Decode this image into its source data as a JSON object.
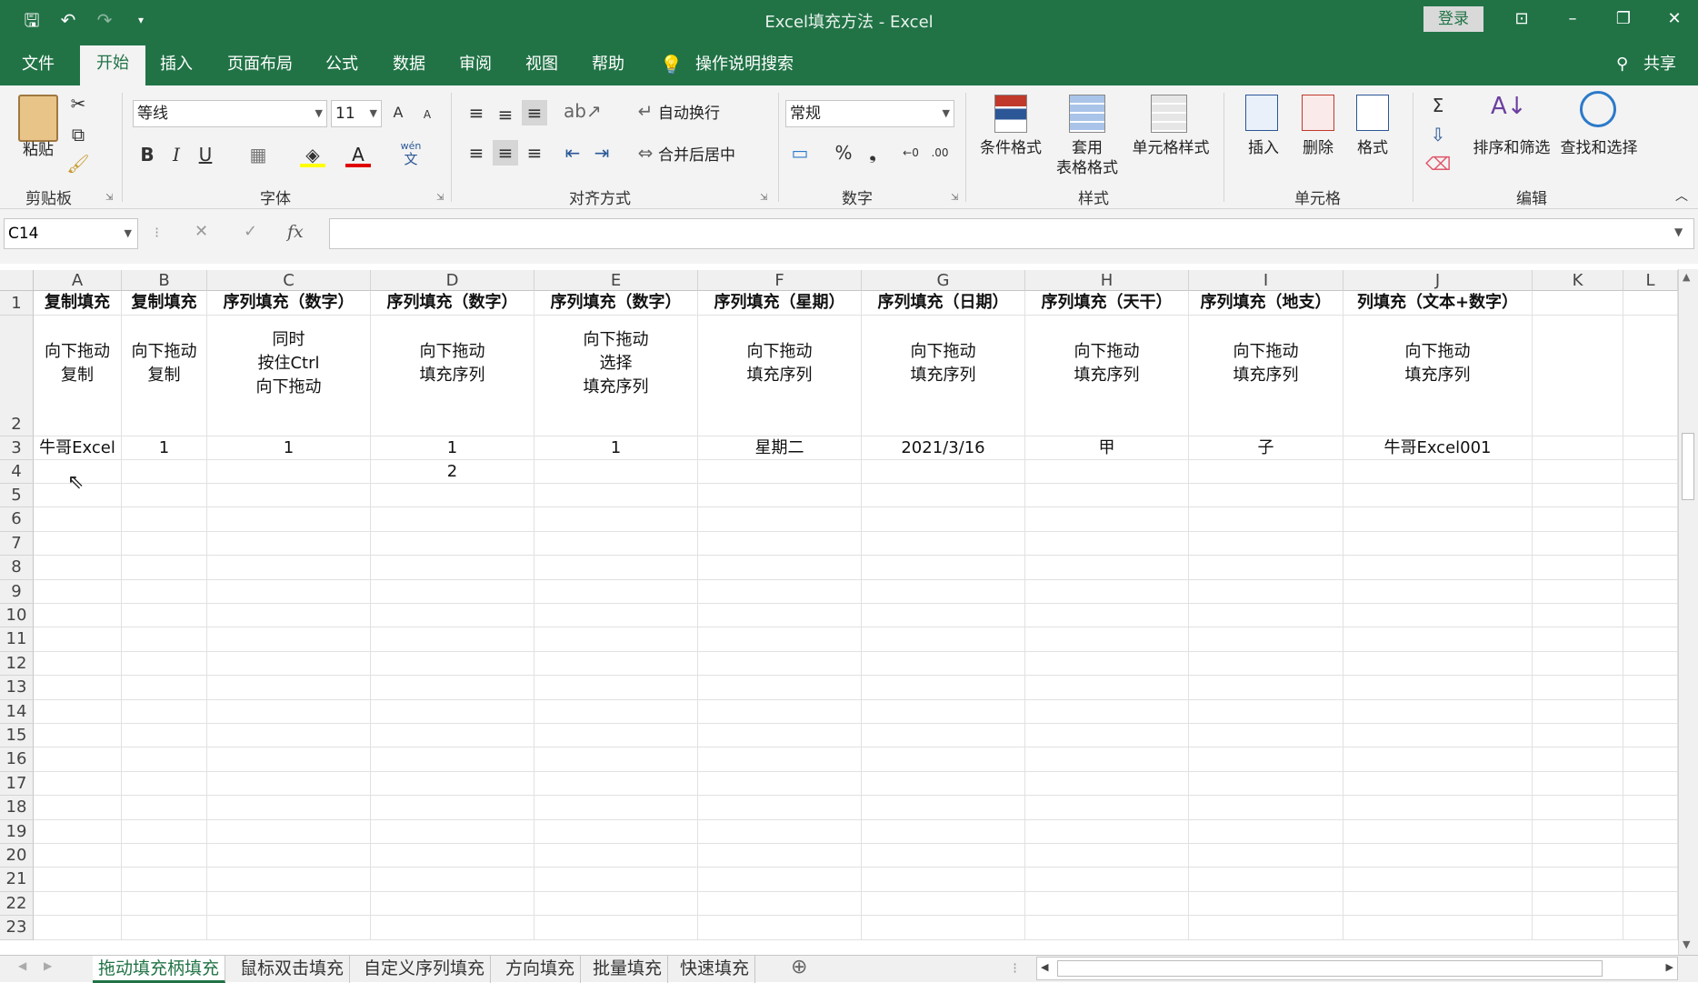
{
  "titlebar": {
    "title": "Excel填充方法  -  Excel",
    "login_label": "登录",
    "icons": [
      "save-icon",
      "undo-icon",
      "redo-icon",
      "customize-icon"
    ],
    "brand_color": "#217346"
  },
  "tabs": [
    "文件",
    "开始",
    "插入",
    "页面布局",
    "公式",
    "数据",
    "审阅",
    "视图",
    "帮助"
  ],
  "active_tab": "开始",
  "tell_me": "操作说明搜索",
  "share": "共享",
  "ribbon": {
    "clipboard": {
      "paste": "粘贴",
      "label": "剪贴板"
    },
    "font": {
      "name": "等线",
      "size": "11",
      "label": "字体",
      "bold": "B",
      "italic": "I",
      "underline": "U",
      "grow": "A",
      "shrink": "A",
      "wen": "wén",
      "wen2": "文"
    },
    "align": {
      "wrap": "自动换行",
      "merge": "合并后居中",
      "label": "对齐方式"
    },
    "number": {
      "format": "常规",
      "label": "数字",
      "percent": "%",
      "comma": "❟"
    },
    "styles": {
      "cond": "条件格式",
      "table1": "套用",
      "table2": "表格格式",
      "cell": "单元格样式",
      "label": "样式"
    },
    "cells": {
      "insert": "插入",
      "delete": "删除",
      "format": "格式",
      "label": "单元格"
    },
    "edit": {
      "sort": "排序和筛选",
      "find": "查找和选择",
      "label": "编辑"
    }
  },
  "formula_bar": {
    "namebox": "C14",
    "fx": "fx",
    "cancel": "✕",
    "enter": "✓",
    "value": ""
  },
  "sheet": {
    "columns": [
      "A",
      "B",
      "C",
      "D",
      "E",
      "F",
      "G",
      "H",
      "I",
      "J",
      "K",
      "L"
    ],
    "row_numbers": [
      "1",
      "2",
      "3",
      "4",
      "5",
      "6",
      "7",
      "8",
      "9",
      "10",
      "11",
      "12",
      "13",
      "14",
      "15",
      "16",
      "17",
      "18",
      "19",
      "20",
      "21",
      "22",
      "23"
    ],
    "row1": [
      "复制填充",
      "复制填充",
      "序列填充（数字）",
      "序列填充（数字）",
      "序列填充（数字）",
      "序列填充（星期）",
      "序列填充（日期）",
      "序列填充（天干）",
      "序列填充（地支）",
      "列填充（文本+数字）",
      "",
      ""
    ],
    "row2": [
      "向下拖动\n复制",
      "向下拖动\n复制",
      "同时\n按住Ctrl\n向下拖动",
      "向下拖动\n填充序列",
      "向下拖动\n选择\n填充序列",
      "向下拖动\n填充序列",
      "向下拖动\n填充序列",
      "向下拖动\n填充序列",
      "向下拖动\n填充序列",
      "向下拖动\n填充序列",
      "",
      ""
    ],
    "row3": [
      "牛哥Excel",
      "1",
      "1",
      "1",
      "1",
      "星期二",
      "2021/3/16",
      "甲",
      "子",
      "牛哥Excel001",
      "",
      ""
    ],
    "row4": [
      "",
      "",
      "",
      "2",
      "",
      "",
      "",
      "",
      "",
      "",
      "",
      ""
    ]
  },
  "sheet_tabs": [
    "拖动填充柄填充",
    "鼠标双击填充",
    "自定义序列填充",
    "方向填充",
    "批量填充",
    "快速填充"
  ],
  "active_sheet": "拖动填充柄填充",
  "add_sheet": "⊕"
}
